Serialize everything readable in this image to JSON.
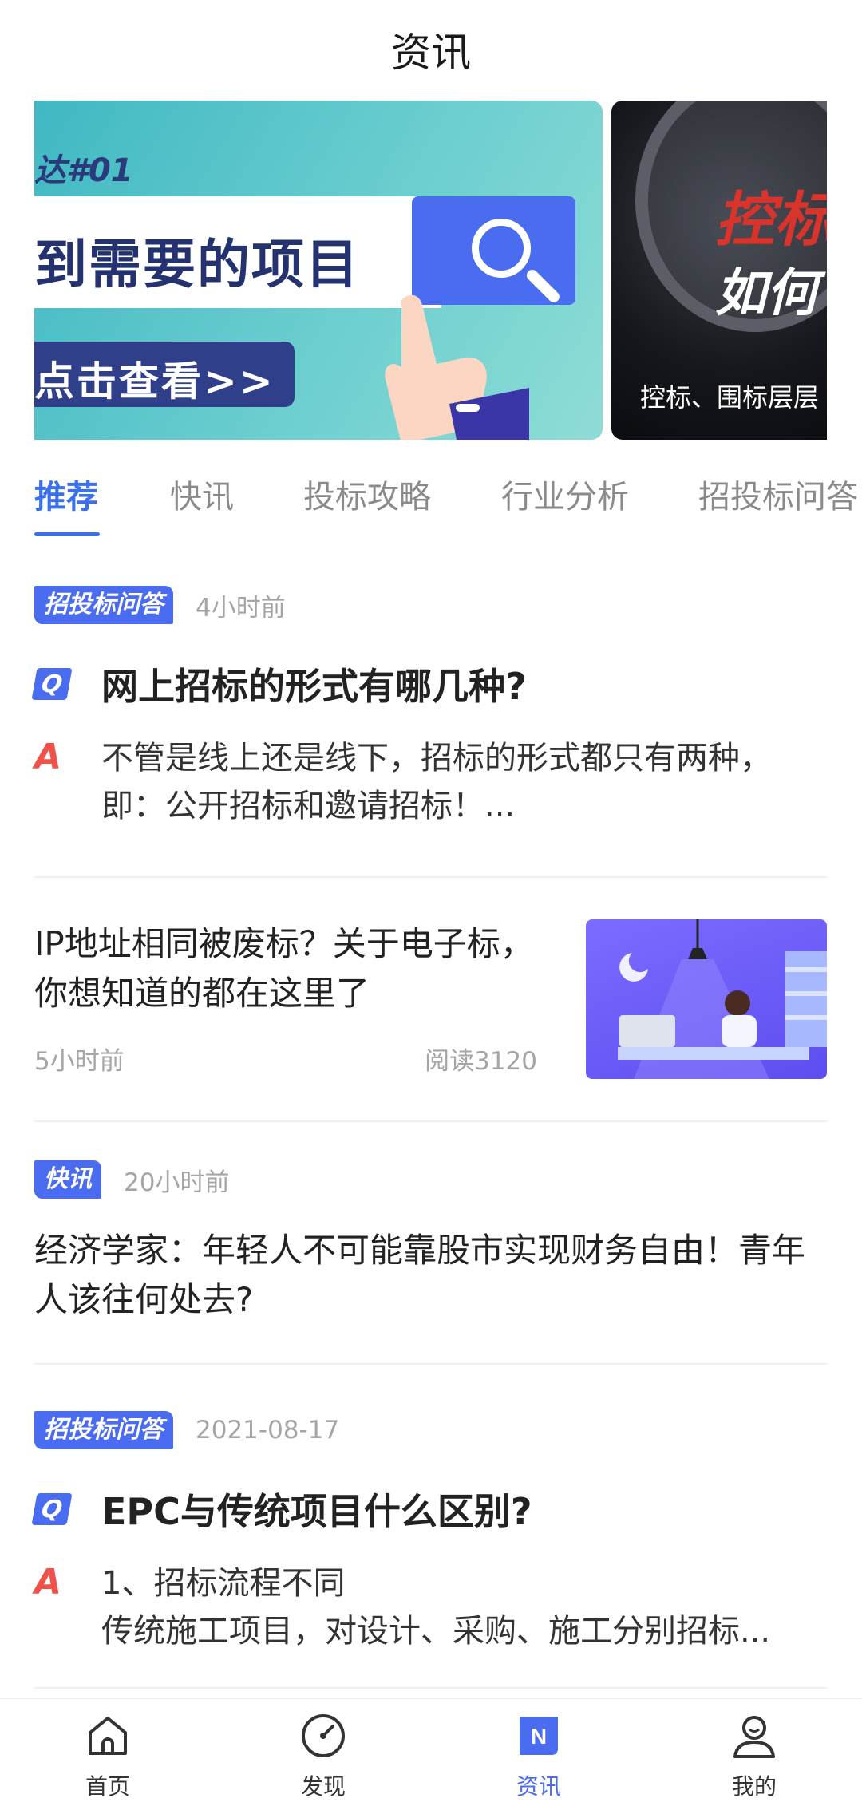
{
  "header": {
    "title": "资讯"
  },
  "banner": {
    "main": {
      "tag": "达#01",
      "search_text": "到需要的项目",
      "cta": "点击查看>>"
    },
    "second": {
      "red_text": "控标",
      "white_text": "如何",
      "caption": "控标、围标层层"
    }
  },
  "tabs": [
    "推荐",
    "快讯",
    "投标攻略",
    "行业分析",
    "招投标问答"
  ],
  "feed": {
    "qa1": {
      "badge": "招投标问答",
      "time": "4小时前",
      "q_icon": "Q",
      "question": "网上招标的形式有哪几种?",
      "a_icon": "A",
      "answer": "不管是线上还是线下，招标的形式都只有两种，即：公开招标和邀请招标！..."
    },
    "article1": {
      "title": "IP地址相同被废标？关于电子标，你想知道的都在这里了",
      "time": "5小时前",
      "reads": "阅读3120"
    },
    "news1": {
      "badge": "快讯",
      "time": "20小时前",
      "title": "经济学家：年轻人不可能靠股市实现财务自由！青年人该往何处去?"
    },
    "qa2": {
      "badge": "招投标问答",
      "time": "2021-08-17",
      "q_icon": "Q",
      "question": "EPC与传统项目什么区别?",
      "a_icon": "A",
      "answer_line1": "1、招标流程不同",
      "answer_line2": "传统施工项目，对设计、采购、施工分别招标..."
    }
  },
  "tabbar": [
    {
      "label": "首页",
      "icon": "home-icon"
    },
    {
      "label": "发现",
      "icon": "compass-icon"
    },
    {
      "label": "资讯",
      "icon": "news-icon",
      "active": true
    },
    {
      "label": "我的",
      "icon": "profile-icon"
    }
  ],
  "colors": {
    "accent": "#4a6cf0",
    "answer_red": "#f0524a",
    "muted": "#a5a5a5"
  }
}
